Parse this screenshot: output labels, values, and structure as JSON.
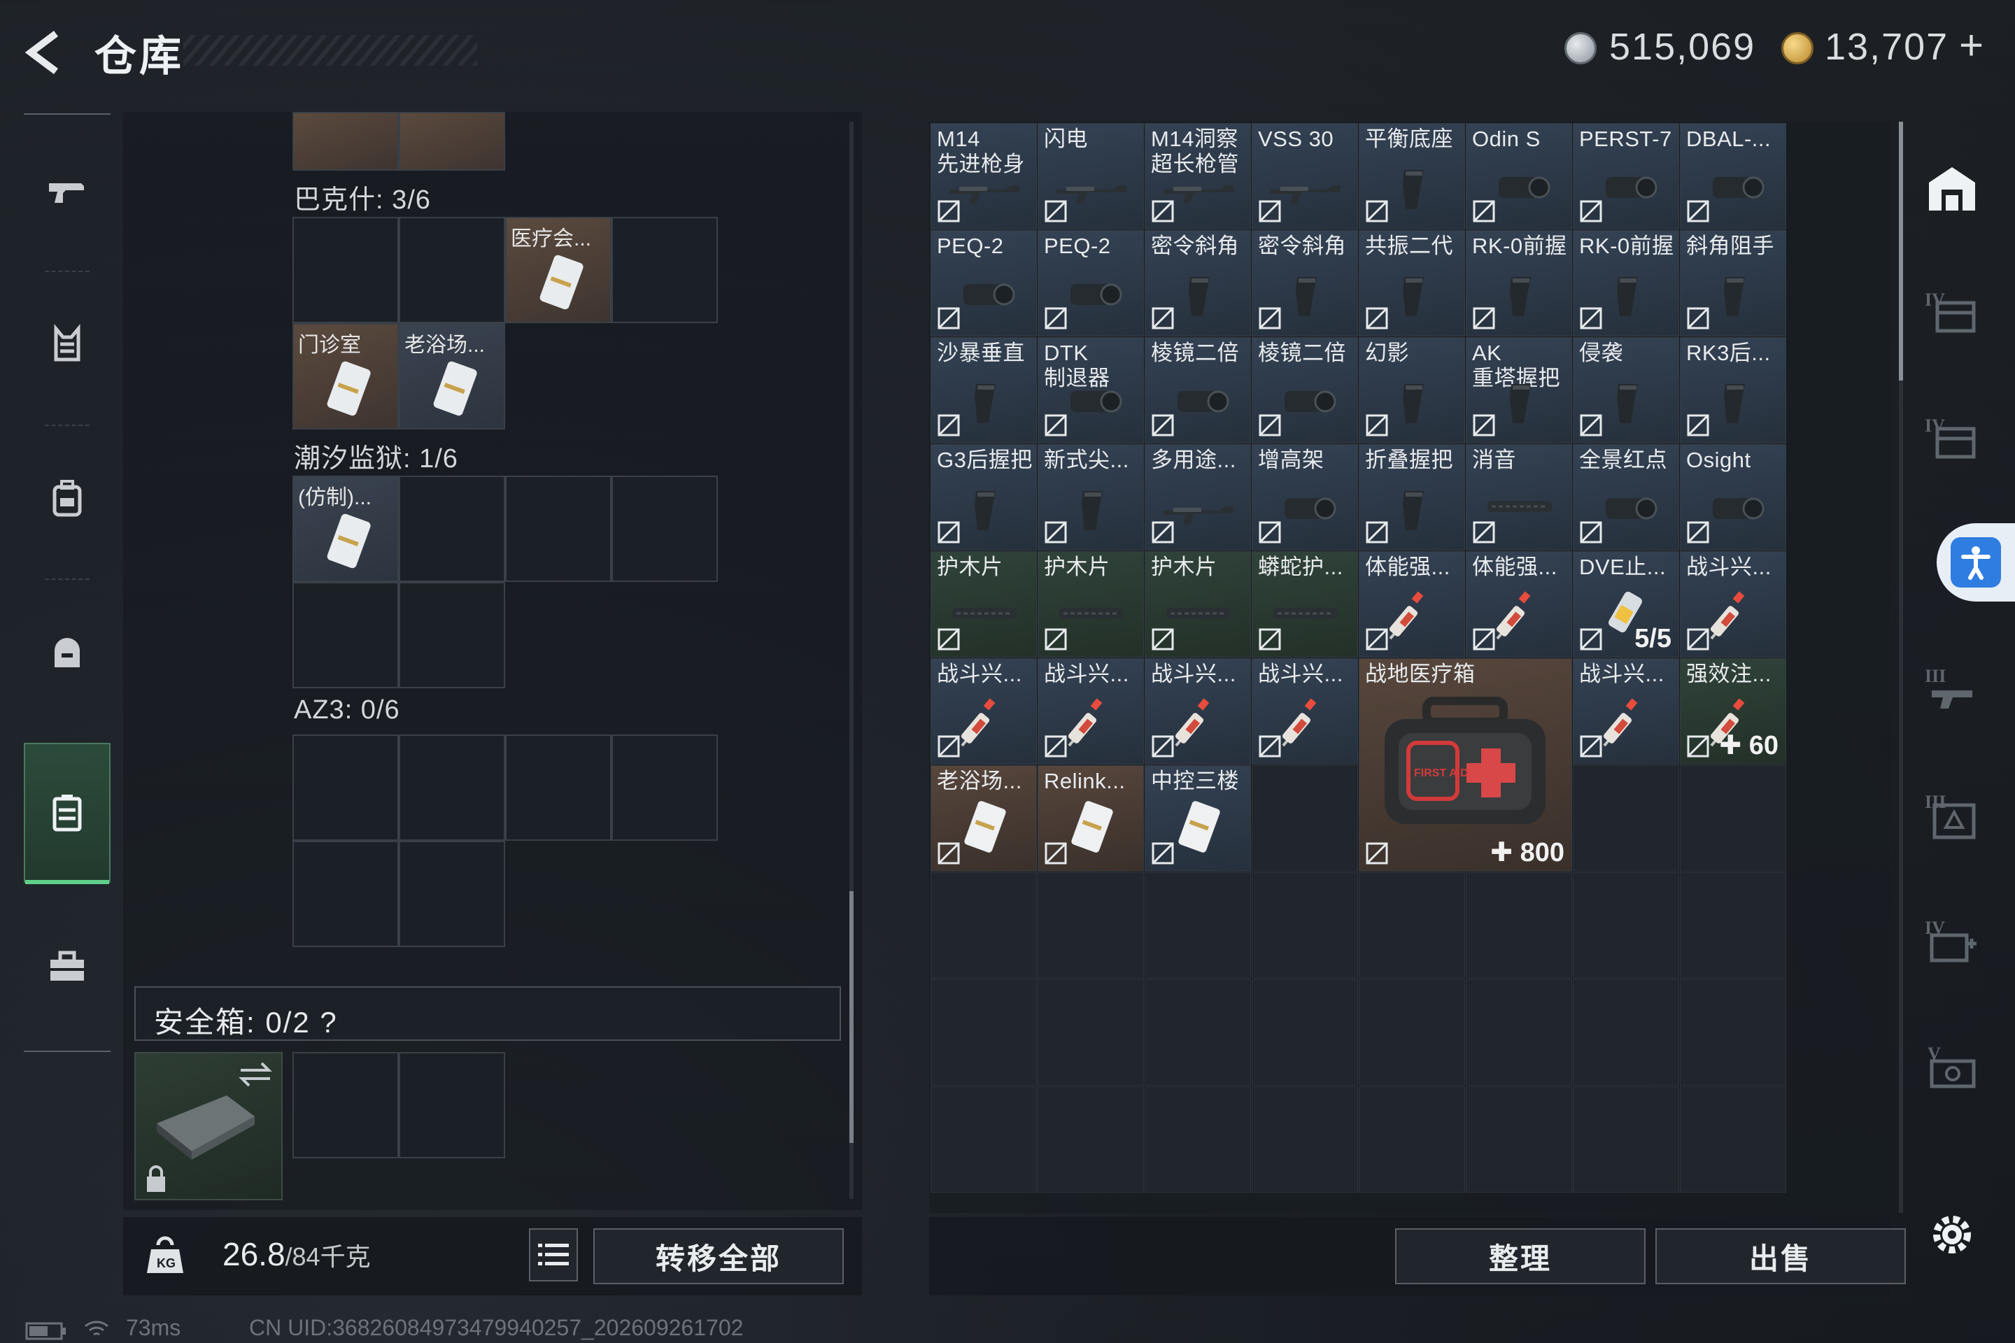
{
  "header": {
    "title": "仓库",
    "currency": [
      {
        "icon": "silver-coin-icon",
        "value": "515,069"
      },
      {
        "icon": "gold-coin-icon",
        "value": "13,707"
      }
    ],
    "add_symbol": "+"
  },
  "left_nav": [
    {
      "icon": "gun-icon"
    },
    {
      "icon": "armor-vest-icon"
    },
    {
      "icon": "backpack-icon"
    },
    {
      "icon": "helmet-bag-icon"
    },
    {
      "icon": "container-icon",
      "active": true
    },
    {
      "icon": "briefcase-icon"
    }
  ],
  "sections": [
    {
      "label": "巴克什: 3/6"
    },
    {
      "label": "潮汐监狱: 1/6"
    },
    {
      "label": "AZ3: 0/6"
    }
  ],
  "keycards": {
    "s1": [
      "医疗会...",
      "门诊室",
      "老浴场..."
    ],
    "s2": [
      "(仿制)..."
    ]
  },
  "safebox": {
    "label": "安全箱: 0/2",
    "help": "?"
  },
  "bottom": {
    "weight": "26.8",
    "weight_max": "/84千克",
    "transfer": "转移全部",
    "sort": "整理",
    "sell": "出售"
  },
  "grid": [
    {
      "name": "M14\n先进枪身",
      "color": "blue",
      "count": ""
    },
    {
      "name": "闪电",
      "color": "blue",
      "count": ""
    },
    {
      "name": "M14洞察\n超长枪管",
      "color": "blue",
      "count": ""
    },
    {
      "name": "VSS 30",
      "color": "blue",
      "count": ""
    },
    {
      "name": "平衡底座",
      "color": "blue",
      "count": ""
    },
    {
      "name": "Odin S",
      "color": "blue",
      "count": ""
    },
    {
      "name": "PERST-7",
      "color": "blue",
      "count": ""
    },
    {
      "name": "DBAL-...",
      "color": "blue",
      "count": ""
    },
    {
      "name": "PEQ-2",
      "color": "blue",
      "count": ""
    },
    {
      "name": "PEQ-2",
      "color": "blue",
      "count": ""
    },
    {
      "name": "密令斜角",
      "color": "blue",
      "count": ""
    },
    {
      "name": "密令斜角",
      "color": "blue",
      "count": ""
    },
    {
      "name": "共振二代",
      "color": "blue",
      "count": ""
    },
    {
      "name": "RK-0前握",
      "color": "blue",
      "count": ""
    },
    {
      "name": "RK-0前握",
      "color": "blue",
      "count": ""
    },
    {
      "name": "斜角阻手",
      "color": "blue",
      "count": ""
    },
    {
      "name": "沙暴垂直",
      "color": "blue",
      "count": ""
    },
    {
      "name": "DTK\n制退器",
      "color": "blue",
      "count": ""
    },
    {
      "name": "棱镜二倍",
      "color": "blue",
      "count": ""
    },
    {
      "name": "棱镜二倍",
      "color": "blue",
      "count": ""
    },
    {
      "name": "幻影",
      "color": "blue",
      "count": ""
    },
    {
      "name": "AK\n重塔握把",
      "color": "blue",
      "count": ""
    },
    {
      "name": "侵袭",
      "color": "blue",
      "count": ""
    },
    {
      "name": "RK3后...",
      "color": "blue",
      "count": ""
    },
    {
      "name": "G3后握把",
      "color": "blue",
      "count": ""
    },
    {
      "name": "新式尖...",
      "color": "blue",
      "count": ""
    },
    {
      "name": "多用途...",
      "color": "blue",
      "count": ""
    },
    {
      "name": "增高架",
      "color": "blue",
      "count": ""
    },
    {
      "name": "折叠握把",
      "color": "blue",
      "count": ""
    },
    {
      "name": "消音",
      "color": "blue",
      "count": ""
    },
    {
      "name": "全景红点",
      "color": "blue",
      "count": ""
    },
    {
      "name": "Osight",
      "color": "blue",
      "count": ""
    },
    {
      "name": "护木片",
      "color": "green",
      "count": ""
    },
    {
      "name": "护木片",
      "color": "green",
      "count": ""
    },
    {
      "name": "护木片",
      "color": "green",
      "count": ""
    },
    {
      "name": "蟒蛇护...",
      "color": "green",
      "count": ""
    },
    {
      "name": "体能强...",
      "color": "blue",
      "count": ""
    },
    {
      "name": "体能强...",
      "color": "blue",
      "count": ""
    },
    {
      "name": "DVE止...",
      "color": "blue",
      "count": "5/5"
    },
    {
      "name": "战斗兴...",
      "color": "blue",
      "count": ""
    },
    {
      "name": "战斗兴...",
      "color": "blue",
      "count": ""
    },
    {
      "name": "战斗兴...",
      "color": "blue",
      "count": ""
    },
    {
      "name": "战斗兴...",
      "color": "blue",
      "count": ""
    },
    {
      "name": "战斗兴...",
      "color": "blue",
      "count": ""
    },
    {
      "name": "战斗兴...",
      "color": "blue",
      "count": ""
    },
    {
      "name": "强效注...",
      "color": "green",
      "count": "60"
    },
    {
      "name": "老浴场...",
      "color": "brown",
      "count": ""
    },
    {
      "name": "Relink...",
      "color": "brown",
      "count": ""
    },
    {
      "name": "中控三楼",
      "color": "blue",
      "count": ""
    }
  ],
  "medkit": {
    "name": "战地医疗箱",
    "count": "800",
    "label": "FIRST AID"
  },
  "status": {
    "ping": "73ms",
    "uid": "CN UID:36826084973479940257_202609261702"
  },
  "colors": {
    "accent_green": "#5fd18a",
    "cell_blue": "#344254",
    "cell_green": "#30433a",
    "cell_brown": "#57463c"
  }
}
